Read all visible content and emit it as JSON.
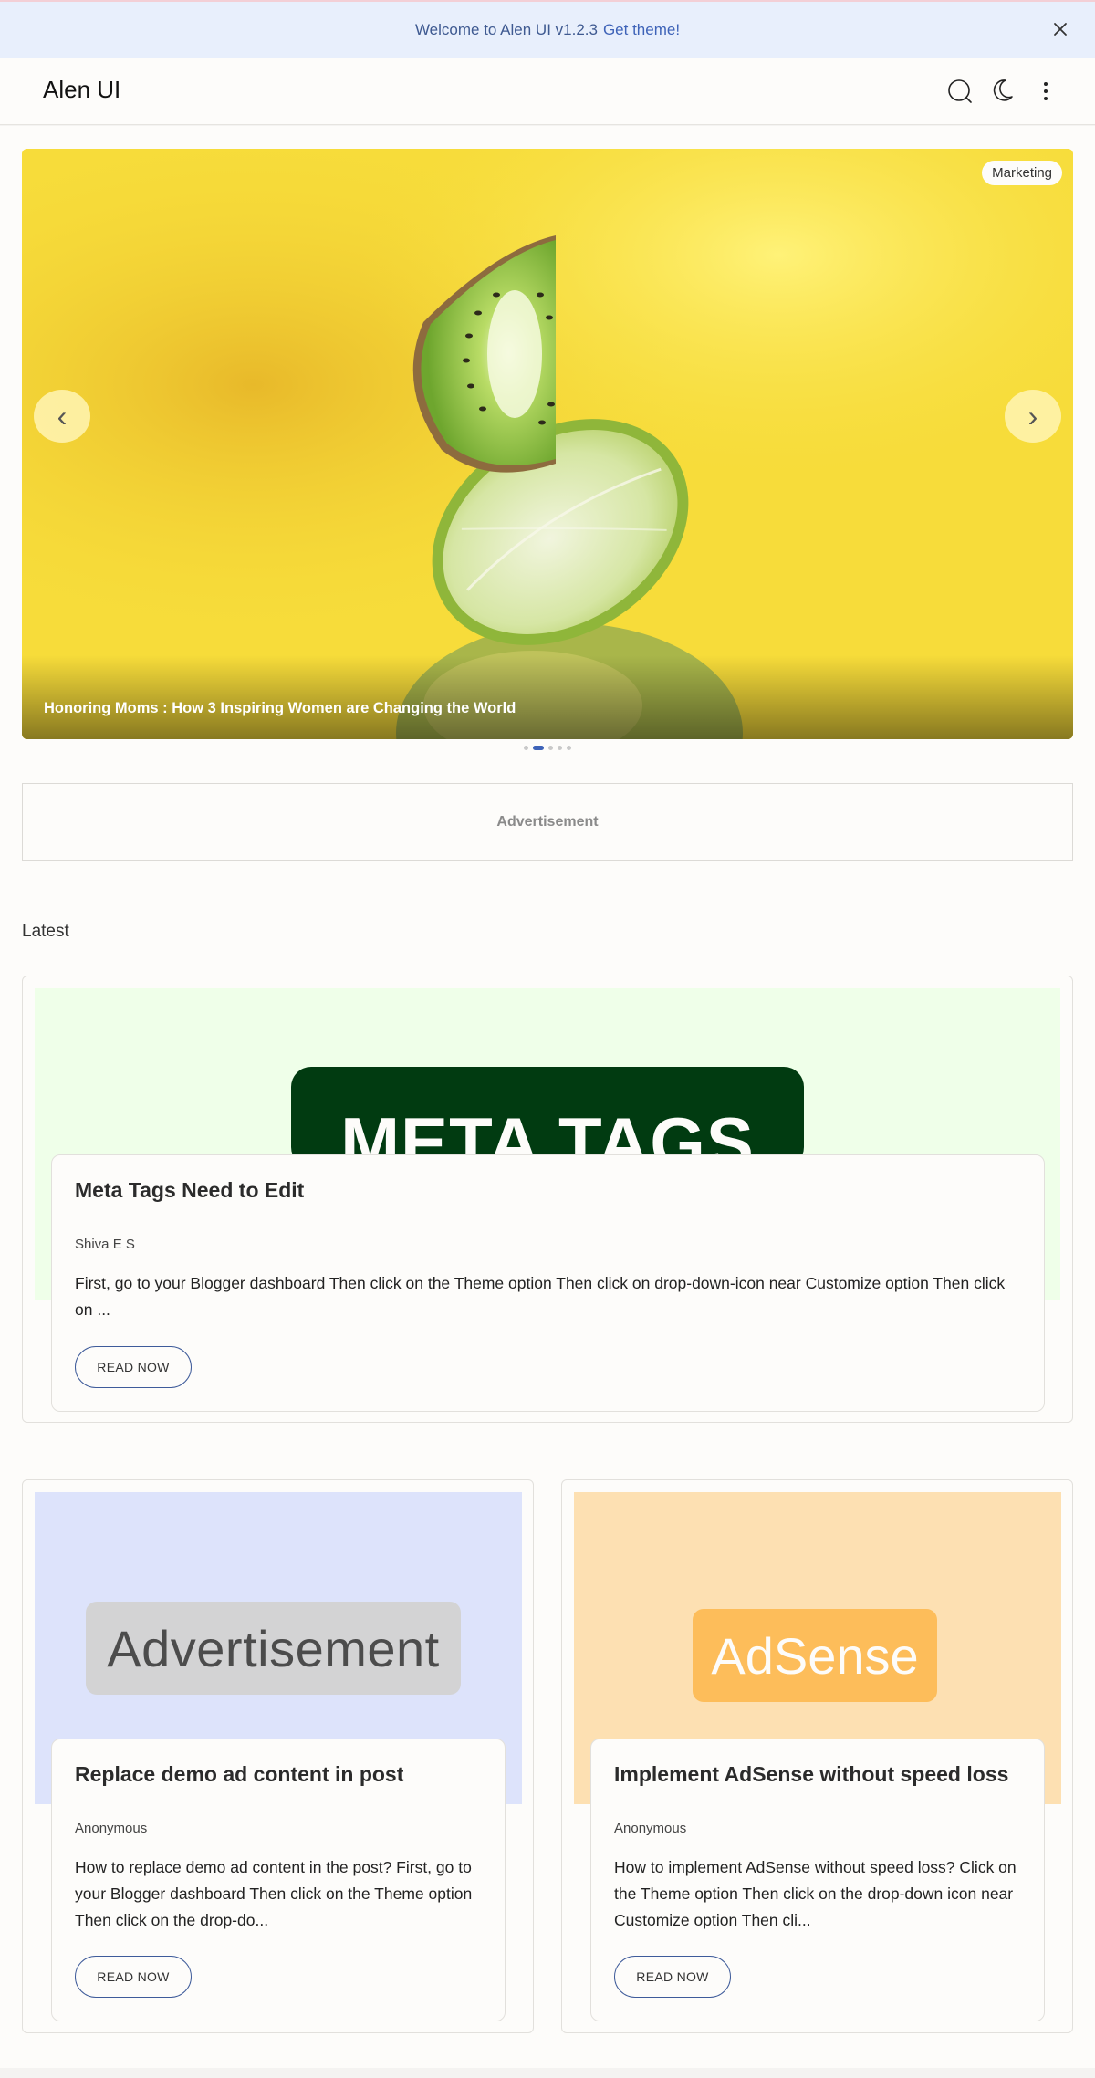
{
  "notice": {
    "text": "Welcome to Alen UI v1.2.3",
    "link": "Get theme!"
  },
  "header": {
    "brand": "Alen UI",
    "icons": [
      "search-icon",
      "moon-icon",
      "more-vertical-icon"
    ]
  },
  "slider": {
    "badge": "Marketing",
    "caption": "Honoring Moms : How 3 Inspiring Women are Changing the World",
    "prev": "‹",
    "next": "›",
    "slide_count": 5,
    "active_slide": 2
  },
  "ad": {
    "label": "Advertisement"
  },
  "latest": {
    "title": "Latest"
  },
  "posts": [
    {
      "thumb_text": "META TAGS",
      "title": "Meta Tags Need to Edit",
      "author": "Shiva E S",
      "excerpt": "First, go to your Blogger dashboard Then click on the  Theme option Then click on drop-down-icon near Customize option Then click on ...",
      "button": "READ NOW"
    },
    {
      "thumb_text": "Advertisement",
      "title": "Replace demo ad content in post",
      "author": "Anonymous",
      "excerpt": " How to replace demo ad content in the post? First, go to your Blogger dashboard Then click on the  Theme option Then click on the  drop-do...",
      "button": "READ NOW"
    },
    {
      "thumb_text": "AdSense",
      "title": "Implement AdSense without speed loss",
      "author": "Anonymous",
      "excerpt": "How to implement AdSense without speed loss? Click on the  Theme option Then click on the  drop-down icon near Customize option Then cli...",
      "button": "READ NOW"
    }
  ],
  "colors": {
    "accent": "#3e63b8",
    "notice_bg": "#e8effc",
    "slide_bg": "#f7dc3a",
    "meta_thumb_bg": "#efffe9",
    "meta_badge": "#013b11",
    "ad_thumb_bg": "#dde3fb",
    "adsense_thumb_bg": "#fde0b2",
    "adsense_badge": "#fdbd5a"
  }
}
